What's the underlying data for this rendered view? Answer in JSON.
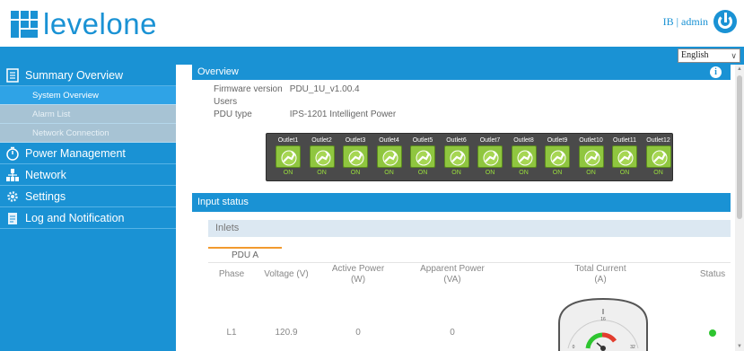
{
  "brand": {
    "logo_text": "levelone",
    "color": "#1a92d4"
  },
  "header": {
    "user_label": "IB | admin",
    "logout_icon": "power-icon"
  },
  "topbar": {
    "language": "English"
  },
  "sidebar": {
    "items": [
      {
        "label": "Summary Overview",
        "icon": "document-icon"
      },
      {
        "label": "Power Management",
        "icon": "timer-icon"
      },
      {
        "label": "Network",
        "icon": "network-icon"
      },
      {
        "label": "Settings",
        "icon": "gear-icon"
      },
      {
        "label": "Log and Notification",
        "icon": "log-icon"
      }
    ],
    "sub_items": [
      {
        "label": "System Overview"
      },
      {
        "label": "Alarm List"
      },
      {
        "label": "Network Connection"
      }
    ]
  },
  "overview": {
    "title": "Overview",
    "firmware_label": "Firmware version",
    "firmware_value": "PDU_1U_v1.00.4",
    "users_label": "Users",
    "pdu_type_label": "PDU type",
    "pdu_type_value": "IPS-1201 Intelligent Power",
    "outlets": [
      {
        "name": "Outlet1",
        "state": "ON"
      },
      {
        "name": "Outlet2",
        "state": "ON"
      },
      {
        "name": "Outlet3",
        "state": "ON"
      },
      {
        "name": "Outlet4",
        "state": "ON"
      },
      {
        "name": "Outlet5",
        "state": "ON"
      },
      {
        "name": "Outlet6",
        "state": "ON"
      },
      {
        "name": "Outlet7",
        "state": "ON"
      },
      {
        "name": "Outlet8",
        "state": "ON"
      },
      {
        "name": "Outlet9",
        "state": "ON"
      },
      {
        "name": "Outlet10",
        "state": "ON"
      },
      {
        "name": "Outlet11",
        "state": "ON"
      },
      {
        "name": "Outlet12",
        "state": "ON"
      }
    ]
  },
  "input_status": {
    "title": "Input status",
    "inlets_label": "Inlets",
    "tab_label": "PDU A",
    "columns": {
      "phase": "Phase",
      "voltage": "Voltage (V)",
      "active_power": "Active Power\n(W)",
      "apparent_power": "Apparent Power\n(VA)",
      "total_current": "Total Current\n(A)",
      "status": "Status"
    },
    "row": {
      "phase": "L1",
      "voltage": "120.9",
      "active_power": "0",
      "apparent_power": "0",
      "status_color": "#2ec530"
    },
    "gauge": {
      "min_label": "0",
      "mid_label": "16",
      "max_label": "32"
    }
  }
}
